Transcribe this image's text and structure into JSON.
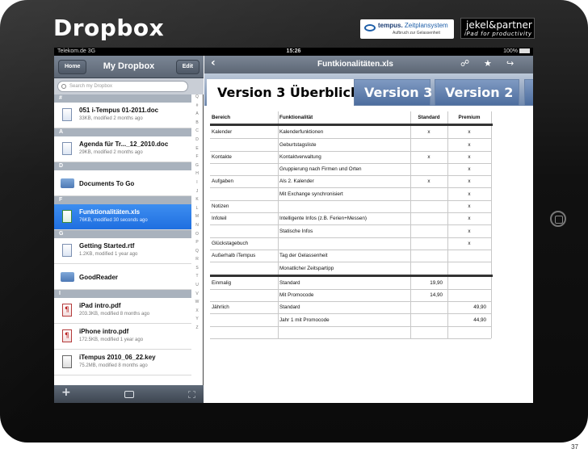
{
  "slide": {
    "title": "Dropbox",
    "page_number": "37"
  },
  "logos": {
    "tempus_name": "tempus.",
    "tempus_product": "Zeitplansystem",
    "tempus_tagline": "Aufbruch zur Gelassenheit",
    "jekel_name": "jekel&partner",
    "jekel_tagline": "iPad for productivity"
  },
  "statusbar": {
    "carrier": "Telekom.de 3G",
    "time": "15:26",
    "battery": "100%"
  },
  "sidebar": {
    "home_button": "Home",
    "title": "My Dropbox",
    "edit_button": "Edit",
    "search_placeholder": "Search my Dropbox",
    "sections": [
      {
        "letter": "#",
        "items": [
          {
            "name": "051 i-Tempus 01-2011.doc",
            "meta": "33KB, modified 2 months ago",
            "kind": "doc"
          }
        ]
      },
      {
        "letter": "A",
        "items": [
          {
            "name": "Agenda für Tr..._12_2010.doc",
            "meta": "29KB, modified 2 months ago",
            "kind": "doc"
          }
        ]
      },
      {
        "letter": "D",
        "items": [
          {
            "name": "Documents To Go",
            "meta": "",
            "kind": "folder"
          }
        ]
      },
      {
        "letter": "F",
        "items": [
          {
            "name": "Funktionalitäten.xls",
            "meta": "76KB, modified 30 seconds ago",
            "kind": "xls",
            "selected": true
          }
        ]
      },
      {
        "letter": "G",
        "items": [
          {
            "name": "Getting Started.rtf",
            "meta": "1.2KB, modified 1 year ago",
            "kind": "doc"
          },
          {
            "name": "GoodReader",
            "meta": "",
            "kind": "folder"
          }
        ]
      },
      {
        "letter": "I",
        "items": [
          {
            "name": "iPad intro.pdf",
            "meta": "203.3KB, modified 8 months ago",
            "kind": "pdf"
          },
          {
            "name": "iPhone intro.pdf",
            "meta": "172.5KB, modified 1 year ago",
            "kind": "pdf"
          },
          {
            "name": "iTempus 2010_06_22.key",
            "meta": "75.2MB, modified 8 months ago",
            "kind": "key"
          }
        ]
      }
    ],
    "index_letters": [
      "Q",
      "#",
      "A",
      "B",
      "C",
      "D",
      "E",
      "F",
      "G",
      "H",
      "I",
      "J",
      "K",
      "L",
      "M",
      "N",
      "O",
      "P",
      "Q",
      "R",
      "S",
      "T",
      "U",
      "V",
      "W",
      "X",
      "Y",
      "Z"
    ]
  },
  "main": {
    "title": "Funtkionalitäten.xls",
    "tabs": [
      "Version 3 Überblick",
      "Version 3",
      "Version 2",
      "V"
    ],
    "table": {
      "headers": [
        "Bereich",
        "Funktionalität",
        "Standard",
        "Premium"
      ],
      "rows": [
        [
          "Kalender",
          "Kalenderfunktionen",
          "x",
          "x"
        ],
        [
          "",
          "Geburtstagsliste",
          "",
          "x"
        ],
        [
          "Kontakte",
          "Kontaktverwaltung",
          "x",
          "x"
        ],
        [
          "",
          "Gruppierung nach Firmen und Orten",
          "",
          "x"
        ],
        [
          "Aufgaben",
          "Als 2. Kalender",
          "x",
          "x"
        ],
        [
          "",
          "Mit Exchange synchronisiert",
          "",
          "x"
        ],
        [
          "Notizen",
          "",
          "",
          "x"
        ],
        [
          "Infoteil",
          "Intelligente Infos (z.B. Ferien+Messen)",
          "",
          "x"
        ],
        [
          "",
          "Statische Infos",
          "",
          "x"
        ],
        [
          "Glückstagebuch",
          "",
          "",
          "x"
        ],
        [
          "Außerhalb iTempus",
          "Tag der Gelassenheit",
          "",
          ""
        ],
        [
          "",
          "Monatlicher Zeitspartipp",
          "",
          ""
        ]
      ],
      "price_rows": [
        [
          "Einmalig",
          "Standard",
          "19,90",
          ""
        ],
        [
          "",
          "Mit Promocode",
          "14,90",
          ""
        ],
        [
          "Jährlich",
          "Standard",
          "",
          "49,90"
        ],
        [
          "",
          "Jahr 1 mit Promocode",
          "",
          "44,90"
        ],
        [
          "",
          "",
          "",
          ""
        ]
      ]
    }
  }
}
